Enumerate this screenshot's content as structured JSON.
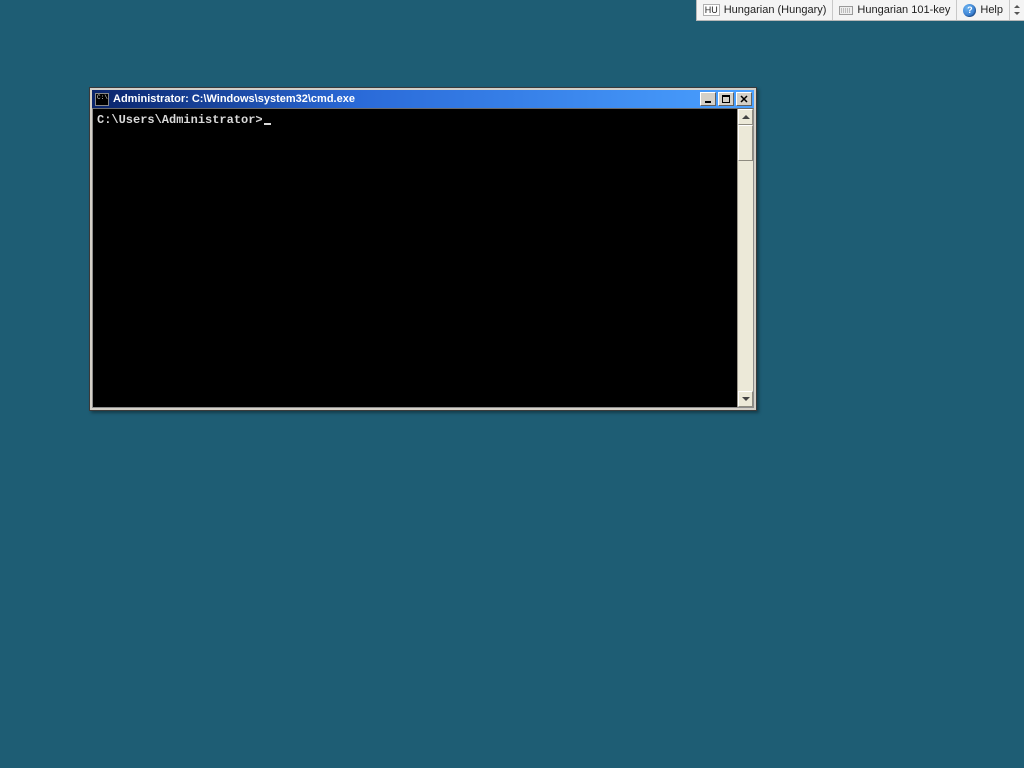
{
  "toolbar": {
    "language_code": "HU",
    "language_label": "Hungarian (Hungary)",
    "keyboard_label": "Hungarian 101-key",
    "help_label": "Help"
  },
  "window": {
    "title": "Administrator: C:\\Windows\\system32\\cmd.exe",
    "prompt": "C:\\Users\\Administrator>"
  }
}
